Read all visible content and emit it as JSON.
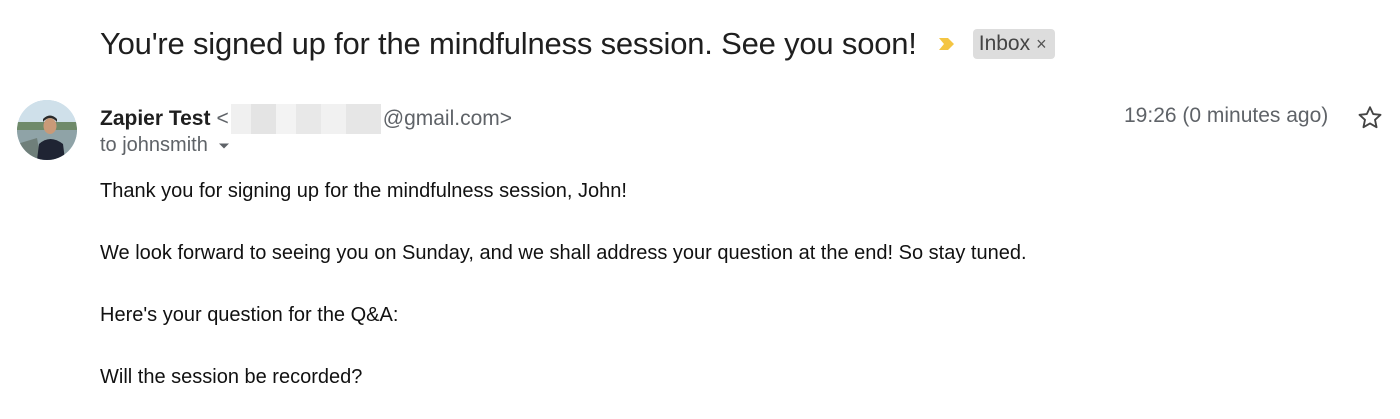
{
  "email": {
    "subject": "You're signed up for the mindfulness session. See you soon!",
    "label": "Inbox",
    "label_close": "×",
    "sender": {
      "name": "Zapier Test",
      "email_prefix": "<",
      "email_suffix": "@gmail.com>"
    },
    "timestamp": "19:26 (0 minutes ago)",
    "recipient": "to johnsmith",
    "body_lines": [
      "Thank you for signing up for the mindfulness session, John!",
      "We look forward to seeing you on Sunday, and we shall address your question at the end! So stay tuned.",
      "Here's your question for the Q&A:",
      "Will the session be recorded?"
    ]
  },
  "colors": {
    "importance": "#f4c542",
    "label_bg": "#dddddd",
    "secondary_text": "#5f6368"
  },
  "icons": {
    "importance": "importance-marker-icon",
    "star": "star-icon",
    "caret": "caret-down-icon"
  }
}
